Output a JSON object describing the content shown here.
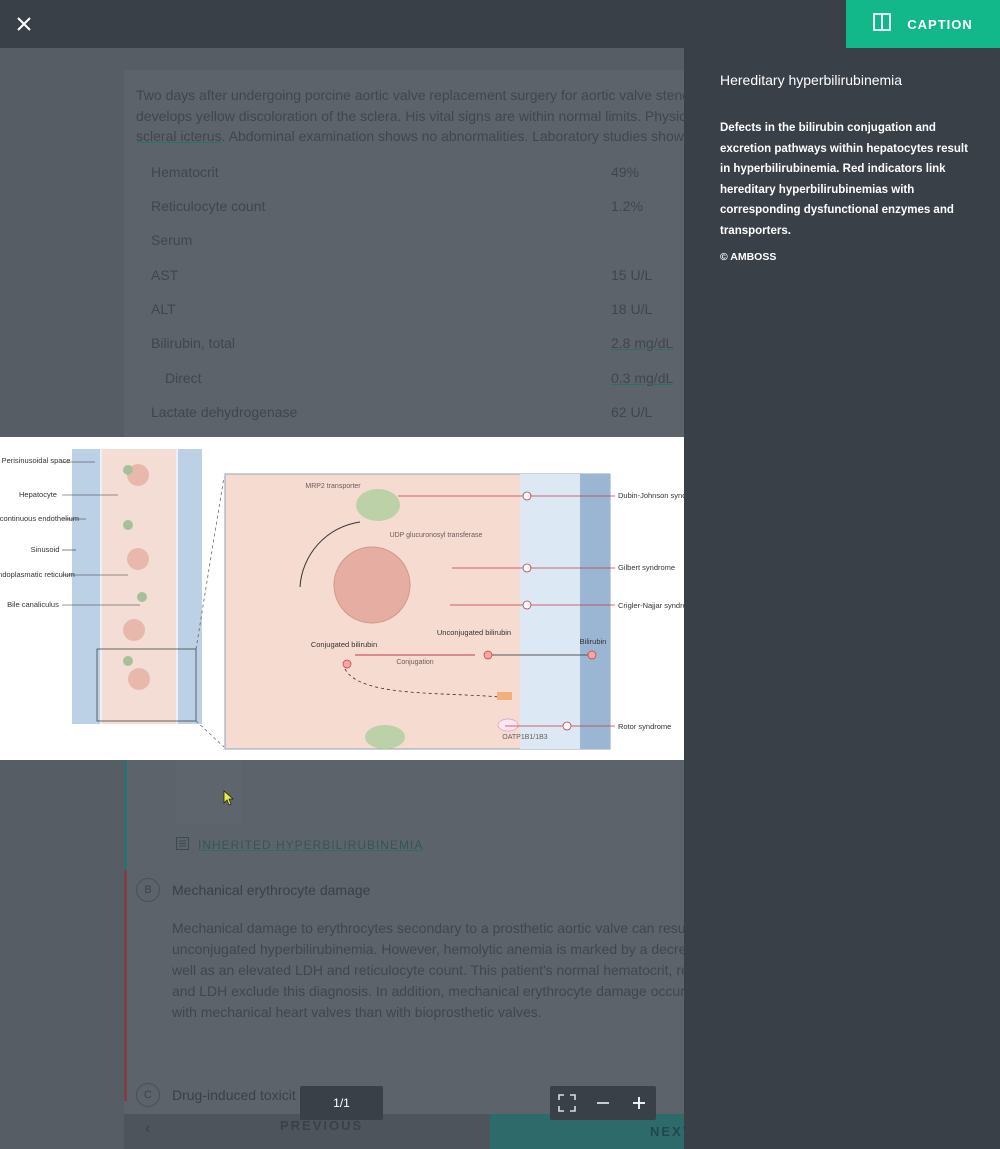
{
  "topbar": {
    "close_icon": "close-icon",
    "caption_label": "CAPTION",
    "caption_icon": "sidebar-panel-icon",
    "accent": "#12b88a"
  },
  "background": {
    "question_lines": [
      "Two days after undergoing porcine aortic valve replacement surgery for aortic valve steno",
      "develops yellow discoloration of the sclera. His vital signs are within normal limits. Physica",
      "scleral icterus",
      ". Abdominal examination shows no abnormalities. Laboratory studies show:"
    ],
    "labs": [
      {
        "name": "Hematocrit",
        "value": "49%"
      },
      {
        "name": "Reticulocyte count",
        "value": "1.2%"
      },
      {
        "name": "Serum",
        "value": ""
      },
      {
        "name": "AST",
        "value": "15 U/L"
      },
      {
        "name": "ALT",
        "value": "18 U/L"
      },
      {
        "name": "Bilirubin, total",
        "value": "2.8 mg/dL"
      },
      {
        "name": "Direct",
        "value": "0.3 mg/dL"
      },
      {
        "name": "Lactate dehydrogenase",
        "value": "62 U/L"
      }
    ],
    "link_label": "INHERITED HYPERBILIRUBINEMIA",
    "option_b": {
      "letter": "B",
      "title": "Mechanical erythrocyte damage",
      "lines": [
        "Mechanical damage to erythrocytes secondary to a prosthetic aortic valve can resul",
        "unconjugated hyperbilirubinemia. However, hemolytic anemia is marked by a decrea",
        "well as an elevated LDH and reticulocyte count. This patient's normal hematocrit, re",
        "and LDH exclude this diagnosis. In addition, mechanical erythrocyte damage occurs",
        "with mechanical heart valves than with bioprosthetic valves."
      ]
    },
    "option_c": {
      "letter": "C",
      "title": "Drug-induced toxicit"
    },
    "nav": {
      "previous": "PREVIOUS",
      "next": "NEXT",
      "prev_icon": "chevron-left-icon"
    }
  },
  "figure": {
    "left_labels": [
      "Perisinusoidal space",
      "Hepatocyte",
      "Discontinuous endothelium",
      "Sinusoid",
      "Endoplasmatic reticulum",
      "Bile canaliculus"
    ],
    "inner_labels": {
      "mrp2": "MRP2 transporter",
      "udp": "UDP glucuronosyl transferase",
      "conjugated": "Conjugated bilirubin",
      "unconjugated": "Unconjugated bilirubin",
      "conjugation": "Conjugation",
      "bilirubin": "Bilirubin",
      "oatp": "OATP1B1/1B3"
    },
    "right_labels": [
      "Dubin-Johnson syndrome",
      "Gilbert syndrome",
      "Crigler-Najjar syndrome",
      "Rotor syndrome"
    ]
  },
  "panel": {
    "title": "Hereditary hyperbilirubinemia",
    "body": "Defects in the bilirubin conjugation and excretion pathways within hepatocytes result in hyperbilirubinemia. Red indicators link hereditary hyperbilirubinemias with corresponding dysfunctional enzymes and transporters.",
    "copyright": "© AMBOSS"
  },
  "controls": {
    "page": "1/1",
    "fullscreen_icon": "fullscreen-icon",
    "zoom_out_icon": "zoom-out-icon",
    "zoom_in_icon": "zoom-in-icon"
  }
}
